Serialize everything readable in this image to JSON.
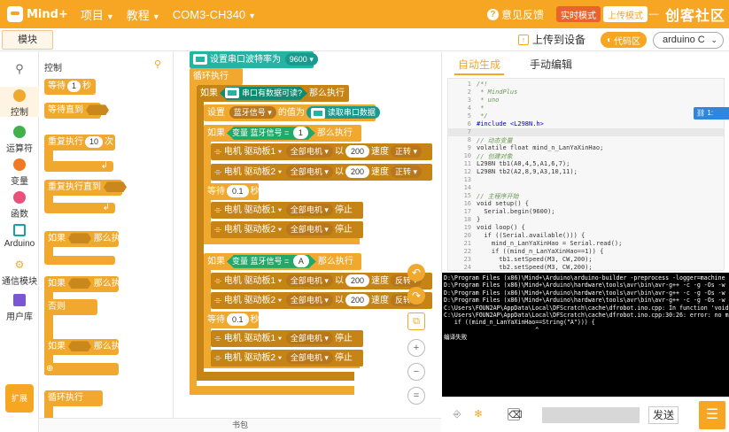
{
  "app": {
    "logo_text": "Mind+",
    "brand_right": "创客社区"
  },
  "menu": {
    "project": "项目",
    "tutorial": "教程",
    "port": "COM3-CH340"
  },
  "top_right": {
    "feedback": "意见反馈",
    "realtime_mode": "实时模式",
    "upload_mode": "上传模式",
    "minimize": "—"
  },
  "subbar": {
    "module_tab": "模块",
    "upload_to_device": "上传到设备",
    "code_area": "代码区",
    "board": "arduino C"
  },
  "nav": [
    {
      "label": "控制",
      "color": "#f0a92e"
    },
    {
      "label": "运算符",
      "color": "#41b14c"
    },
    {
      "label": "变量",
      "color": "#ef7a21"
    },
    {
      "label": "函数",
      "color": "#e9507a"
    },
    {
      "label": "Arduino",
      "color": "#16a3a3"
    },
    {
      "label": "通信模块",
      "color": "#f0a92e"
    },
    {
      "label": "用户库",
      "color": "#7a55d4"
    }
  ],
  "nav_expand": "扩展",
  "palette": {
    "category": "控制",
    "wait": "等待",
    "wait_num": "1",
    "wait_unit": "秒",
    "wait_until": "等待直到",
    "repeat": "重复执行",
    "repeat_num": "10",
    "repeat_unit": "次",
    "repeat_until": "重复执行直到",
    "if_then": "如果",
    "then": "那么执行",
    "else": "否则",
    "loop": "循环执行"
  },
  "bottom_label": "书包",
  "blocks": {
    "set_baud": "设置串口波特率为",
    "baud": "9600",
    "loop": "循环执行",
    "if1": "如果",
    "serial_available": "串口有数据可读?",
    "then": "那么执行",
    "set": "设置",
    "var_name": "蓝牙信号",
    "value_is": "的值为",
    "read_serial": "读取串口数据",
    "if2": "如果",
    "var_label": "变量 蓝牙信号",
    "eq": "=",
    "val1": "1",
    "motor": "电机",
    "driver1": "驱动板1",
    "driver2": "驱动板2",
    "all_motors": "全部电机",
    "by": "以",
    "speed_val": "200",
    "speed": "速度",
    "forward": "正转",
    "reverse": "反转",
    "wait": "等待",
    "wait_val": "0.1",
    "sec": "秒",
    "stop": "停止",
    "valA": "A"
  },
  "code_tabs": {
    "auto": "自动生成",
    "manual": "手动编辑"
  },
  "code_lines": [
    {
      "n": "1",
      "t": "/*!",
      "c": "cm"
    },
    {
      "n": "2",
      "t": " * MindPlus",
      "c": "cm"
    },
    {
      "n": "3",
      "t": " * uno",
      "c": "cm"
    },
    {
      "n": "4",
      "t": " *",
      "c": "cm"
    },
    {
      "n": "5",
      "t": " */",
      "c": "cm"
    },
    {
      "n": "6",
      "t": "#include <L298N.h>",
      "c": "kw"
    },
    {
      "n": "7",
      "t": "",
      "c": ""
    },
    {
      "n": "8",
      "t": "// 动态变量",
      "c": "cm"
    },
    {
      "n": "9",
      "t": "volatile float mind_n_LanYaXinHao;",
      "c": "fn"
    },
    {
      "n": "10",
      "t": "// 创建对象",
      "c": "cm"
    },
    {
      "n": "11",
      "t": "L298N tb1(A0,4,5,A1,6,7);",
      "c": "fn"
    },
    {
      "n": "12",
      "t": "L298N tb2(A2,8,9,A3,10,11);",
      "c": "fn"
    },
    {
      "n": "13",
      "t": "",
      "c": ""
    },
    {
      "n": "14",
      "t": "",
      "c": ""
    },
    {
      "n": "15",
      "t": "// 主程序开始",
      "c": "cm"
    },
    {
      "n": "16",
      "t": "void setup() {",
      "c": "fn"
    },
    {
      "n": "17",
      "t": "  Serial.begin(9600);",
      "c": "fn"
    },
    {
      "n": "18",
      "t": "}",
      "c": "fn"
    },
    {
      "n": "19",
      "t": "void loop() {",
      "c": "fn"
    },
    {
      "n": "20",
      "t": "  if ((Serial.available())) {",
      "c": "fn"
    },
    {
      "n": "21",
      "t": "    mind_n_LanYaXinHao = Serial.read();",
      "c": "fn"
    },
    {
      "n": "22",
      "t": "    if ((mind_n_LanYaXinHao==1)) {",
      "c": "fn"
    },
    {
      "n": "23",
      "t": "      tb1.setSpeed(M3, CW,200);",
      "c": "fn"
    },
    {
      "n": "24",
      "t": "      tb2.setSpeed(M3, CW,200);",
      "c": "fn"
    }
  ],
  "console_lines": [
    "D:\\Program Files (x86)\\Mind+\\Arduino\\arduino-builder -preprocess -logger=machine",
    "D:\\Program Files (x86)\\Mind+\\Arduino\\hardware\\tools\\avr\\bin\\avr-g++ -c -g -Os -w",
    "D:\\Program Files (x86)\\Mind+\\Arduino\\hardware\\tools\\avr\\bin\\avr-g++ -c -g -Os -w",
    "D:\\Program Files (x86)\\Mind+\\Arduino\\hardware\\tools\\avr\\bin\\avr-g++ -c -g -Os -w",
    "C:\\Users\\FOUN2AP\\AppData\\Local\\DFScratch\\cache\\dfrobot.ino.cpp: In function 'void",
    "C:\\Users\\FOUN2AP\\AppData\\Local\\DFScratch\\cache\\dfrobot.ino.cpp:30:26: error: no m",
    "   if ((mind_n_LanYaXinHao==String(\"A\"))) {",
    "                          ^",
    "编译失败"
  ],
  "serial": {
    "send": "发送"
  }
}
